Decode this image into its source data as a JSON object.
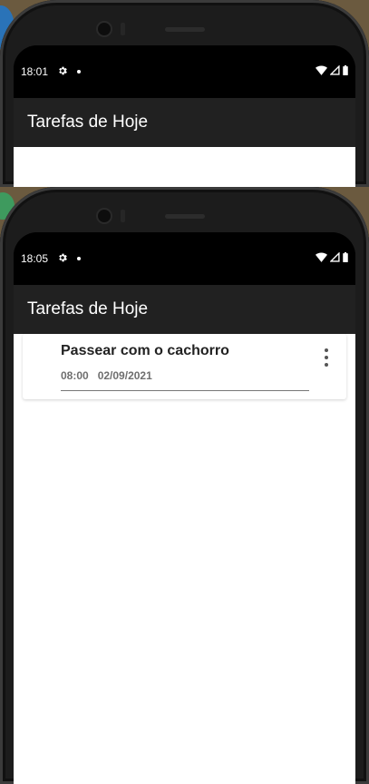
{
  "screens": [
    {
      "status_time": "18:01",
      "app_title": "Tarefas de Hoje",
      "tasks": []
    },
    {
      "status_time": "18:05",
      "app_title": "Tarefas de Hoje",
      "tasks": [
        {
          "title": "Passear com o cachorro",
          "time": "08:00",
          "date": "02/09/2021"
        }
      ]
    }
  ],
  "icons": {
    "settings": "gear-icon",
    "notification_dot": "dot-icon",
    "wifi": "wifi-icon",
    "signal": "signal-icon",
    "battery": "battery-icon",
    "overflow_menu": "more-vert-icon"
  },
  "colors": {
    "status_bar": "#000000",
    "app_bar": "#212121",
    "content_background": "#ffffff",
    "title_text": "#222222",
    "meta_text": "#6f6f6f"
  }
}
